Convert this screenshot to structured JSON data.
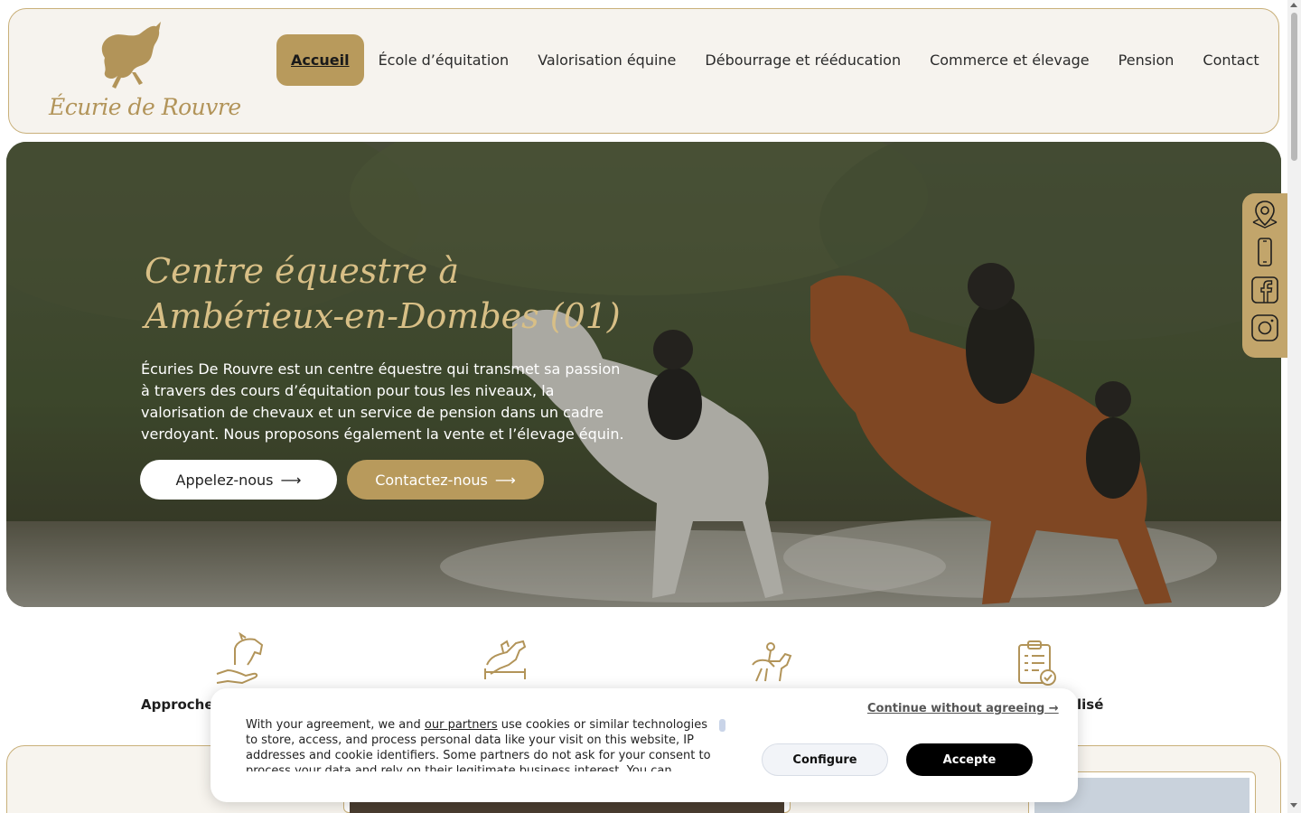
{
  "header": {
    "logo_text": "Écurie de Rouvre",
    "nav": [
      {
        "label": "Accueil",
        "active": true
      },
      {
        "label": "École d’équitation"
      },
      {
        "label": "Valorisation équine"
      },
      {
        "label": "Débourrage et rééducation"
      },
      {
        "label": "Commerce et élevage"
      },
      {
        "label": "Pension"
      },
      {
        "label": "Contact"
      }
    ]
  },
  "hero": {
    "title": "Centre équestre à Ambérieux-en-Dombes (01)",
    "description": "Écuries De Rouvre est un centre équestre qui transmet sa passion à travers des cours d’équitation pour tous les niveaux, la valorisation de chevaux et un service de pension dans un cadre verdoyant. Nous proposons également la vente et l’élevage équin.",
    "call_button": "Appelez-nous",
    "contact_button": "Contactez-nous",
    "arrow": "⟶"
  },
  "social": {
    "icons": [
      "map-pin-icon",
      "phone-icon",
      "facebook-icon",
      "instagram-icon"
    ]
  },
  "features": [
    {
      "label": "Approche c",
      "icon": "hand-horse-icon"
    },
    {
      "label": "",
      "icon": "jumping-horse-icon"
    },
    {
      "label": "",
      "icon": "rider-icon"
    },
    {
      "label": "lisé",
      "icon": "checklist-icon"
    }
  ],
  "cookie": {
    "text_before_link": "With your agreement, we and ",
    "link": "our partners",
    "text_after_link": " use cookies or similar technologies to store, access, and process personal data like your visit on this website, IP addresses and cookie identifiers. Some partners do not ask for your consent to process your data and rely on their legitimate business interest. You can",
    "continue": "Continue without agreeing →",
    "configure": "Configure",
    "accept": "Accepte"
  },
  "colors": {
    "gold": "#b89a5c",
    "cream": "#f6f3ee",
    "border_gold": "#c9b07a"
  }
}
